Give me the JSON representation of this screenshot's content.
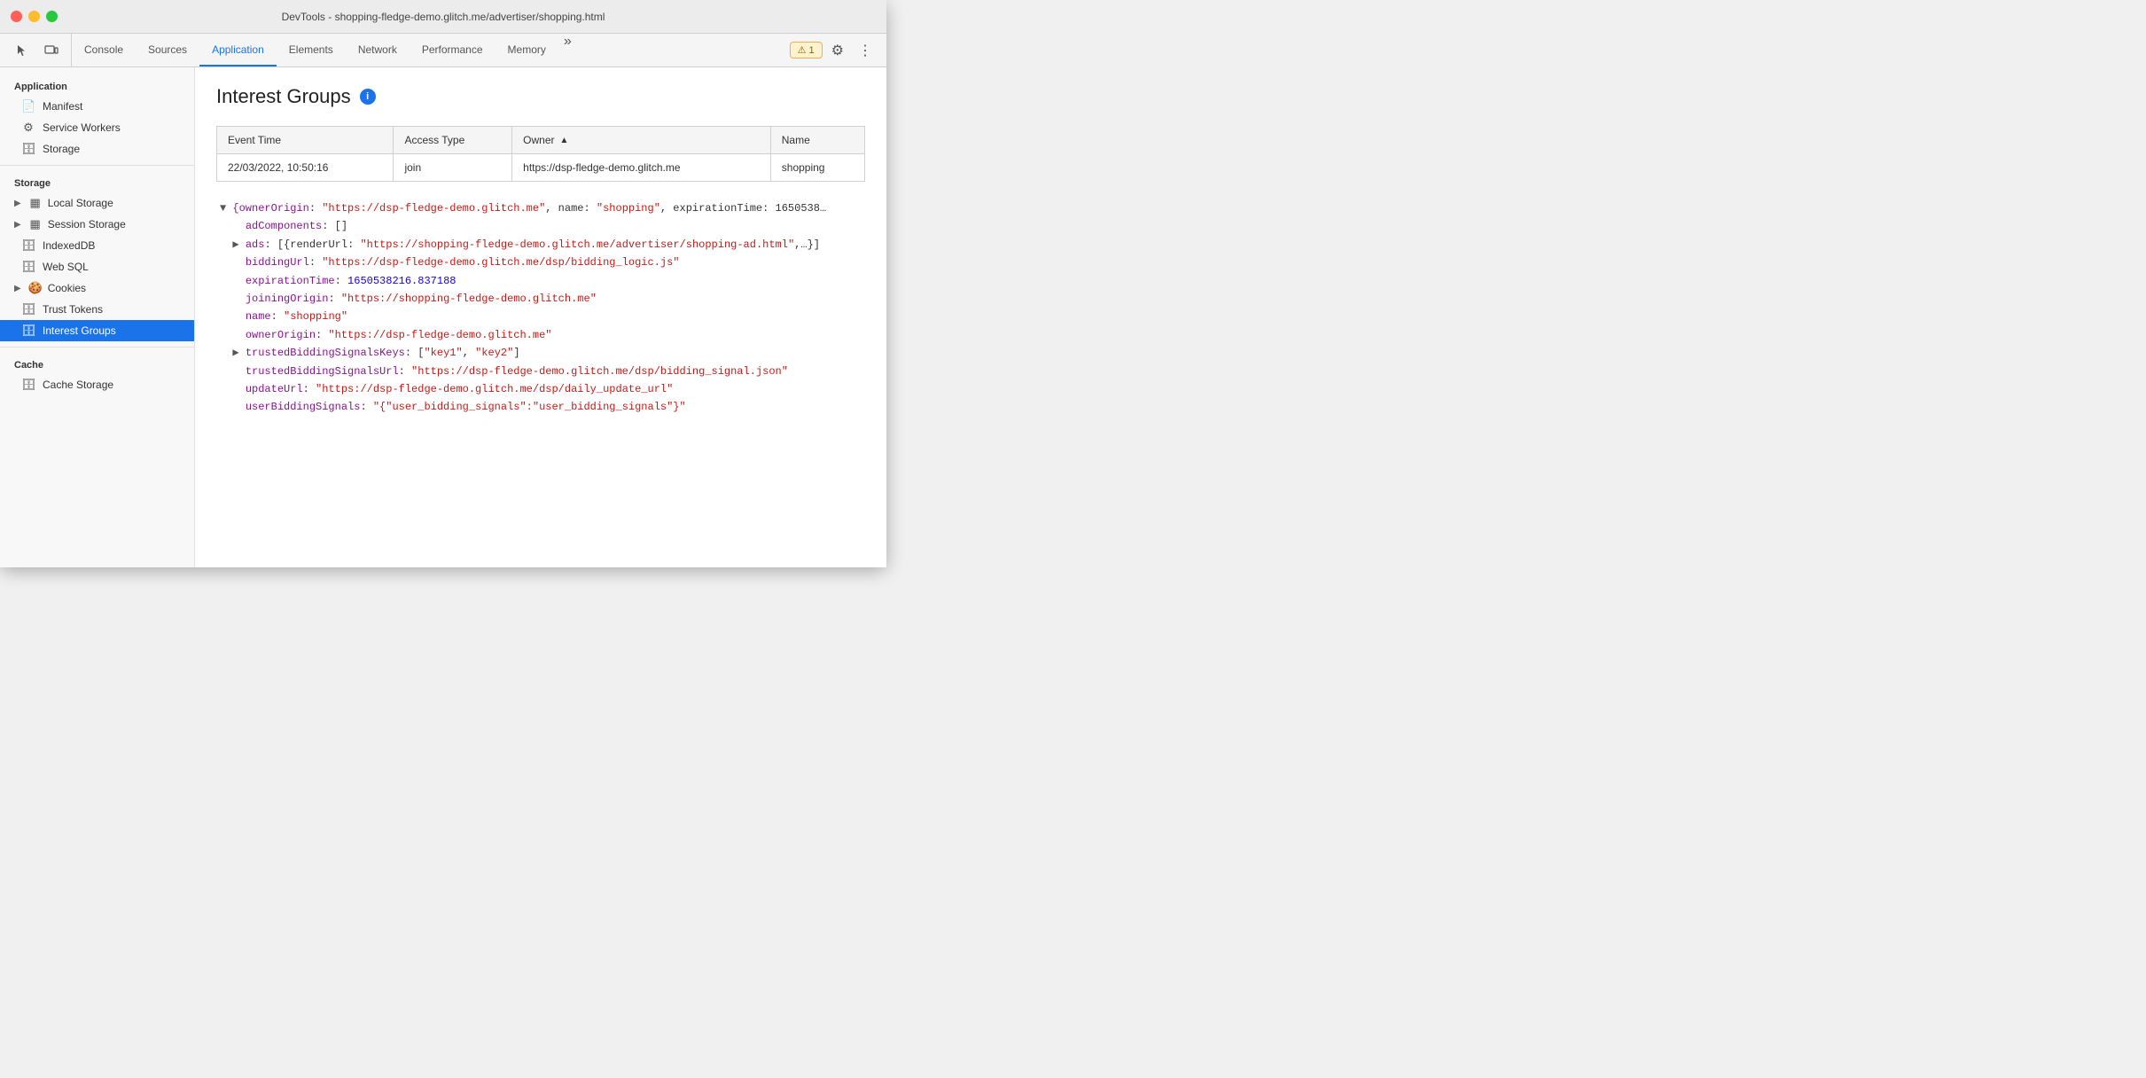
{
  "titlebar": {
    "title": "DevTools - shopping-fledge-demo.glitch.me/advertiser/shopping.html"
  },
  "tabbar": {
    "tabs": [
      {
        "id": "console",
        "label": "Console",
        "active": false
      },
      {
        "id": "sources",
        "label": "Sources",
        "active": false
      },
      {
        "id": "application",
        "label": "Application",
        "active": true
      },
      {
        "id": "elements",
        "label": "Elements",
        "active": false
      },
      {
        "id": "network",
        "label": "Network",
        "active": false
      },
      {
        "id": "performance",
        "label": "Performance",
        "active": false
      },
      {
        "id": "memory",
        "label": "Memory",
        "active": false
      }
    ],
    "more_label": "»",
    "warning_badge": "⚠ 1"
  },
  "sidebar": {
    "sections": [
      {
        "title": "Application",
        "items": [
          {
            "id": "manifest",
            "label": "Manifest",
            "icon": "📄",
            "active": false
          },
          {
            "id": "service-workers",
            "label": "Service Workers",
            "icon": "⚙",
            "active": false
          },
          {
            "id": "storage",
            "label": "Storage",
            "icon": "🗄",
            "active": false
          }
        ]
      },
      {
        "title": "Storage",
        "items": [
          {
            "id": "local-storage",
            "label": "Local Storage",
            "icon": "▦",
            "active": false,
            "group": true
          },
          {
            "id": "session-storage",
            "label": "Session Storage",
            "icon": "▦",
            "active": false,
            "group": true
          },
          {
            "id": "indexeddb",
            "label": "IndexedDB",
            "icon": "🗄",
            "active": false
          },
          {
            "id": "web-sql",
            "label": "Web SQL",
            "icon": "🗄",
            "active": false
          },
          {
            "id": "cookies",
            "label": "Cookies",
            "icon": "🍪",
            "active": false,
            "group": true
          },
          {
            "id": "trust-tokens",
            "label": "Trust Tokens",
            "icon": "🗄",
            "active": false
          },
          {
            "id": "interest-groups",
            "label": "Interest Groups",
            "icon": "🗄",
            "active": true
          }
        ]
      },
      {
        "title": "Cache",
        "items": [
          {
            "id": "cache-storage",
            "label": "Cache Storage",
            "icon": "🗄",
            "active": false
          }
        ]
      }
    ]
  },
  "content": {
    "title": "Interest Groups",
    "table": {
      "headers": [
        "Event Time",
        "Access Type",
        "Owner",
        "Name"
      ],
      "rows": [
        {
          "event_time": "22/03/2022, 10:50:16",
          "access_type": "join",
          "owner": "https://dsp-fledge-demo.glitch.me",
          "name": "shopping"
        }
      ]
    },
    "json_detail": {
      "lines": [
        {
          "indent": 0,
          "content": "▼ {ownerOrigin: \"https://dsp-fledge-demo.glitch.me\", name: \"shopping\", expirationTime: 1650538…",
          "type": "bracket"
        },
        {
          "indent": 1,
          "content": "  adComponents: []",
          "key": "adComponents",
          "value": "[]",
          "type": "array"
        },
        {
          "indent": 1,
          "content": "  ▶ ads: [{renderUrl: \"https://shopping-fledge-demo.glitch.me/advertiser/shopping-ad.html\",…}]",
          "type": "array-collapsed"
        },
        {
          "indent": 1,
          "content": "  biddingUrl: \"https://dsp-fledge-demo.glitch.me/dsp/bidding_logic.js\"",
          "key": "biddingUrl",
          "value": "\"https://dsp-fledge-demo.glitch.me/dsp/bidding_logic.js\"",
          "type": "string"
        },
        {
          "indent": 1,
          "content": "  expirationTime: 1650538216.837188",
          "key": "expirationTime",
          "value": "1650538216.837188",
          "type": "number"
        },
        {
          "indent": 1,
          "content": "  joiningOrigin: \"https://shopping-fledge-demo.glitch.me\"",
          "key": "joiningOrigin",
          "value": "\"https://shopping-fledge-demo.glitch.me\"",
          "type": "string"
        },
        {
          "indent": 1,
          "content": "  name: \"shopping\"",
          "key": "name",
          "value": "\"shopping\"",
          "type": "string"
        },
        {
          "indent": 1,
          "content": "  ownerOrigin: \"https://dsp-fledge-demo.glitch.me\"",
          "key": "ownerOrigin",
          "value": "\"https://dsp-fledge-demo.glitch.me\"",
          "type": "string"
        },
        {
          "indent": 1,
          "content": "  ▶ trustedBiddingSignalsKeys: [\"key1\", \"key2\"]",
          "type": "array-collapsed"
        },
        {
          "indent": 1,
          "content": "  trustedBiddingSignalsUrl: \"https://dsp-fledge-demo.glitch.me/dsp/bidding_signal.json\"",
          "key": "trustedBiddingSignalsUrl",
          "value": "\"https://dsp-fledge-demo.glitch.me/dsp/bidding_signal.json\"",
          "type": "string"
        },
        {
          "indent": 1,
          "content": "  updateUrl: \"https://dsp-fledge-demo.glitch.me/dsp/daily_update_url\"",
          "key": "updateUrl",
          "value": "\"https://dsp-fledge-demo.glitch.me/dsp/daily_update_url\"",
          "type": "string"
        },
        {
          "indent": 1,
          "content": "  userBiddingSignals: \"{\\\"user_bidding_signals\\\":\\\"user_bidding_signals\\\"}\"",
          "key": "userBiddingSignals",
          "value": "\"{\\\"user_bidding_signals\\\":\\\"user_bidding_signals\\\"}\"",
          "type": "string"
        }
      ]
    }
  }
}
